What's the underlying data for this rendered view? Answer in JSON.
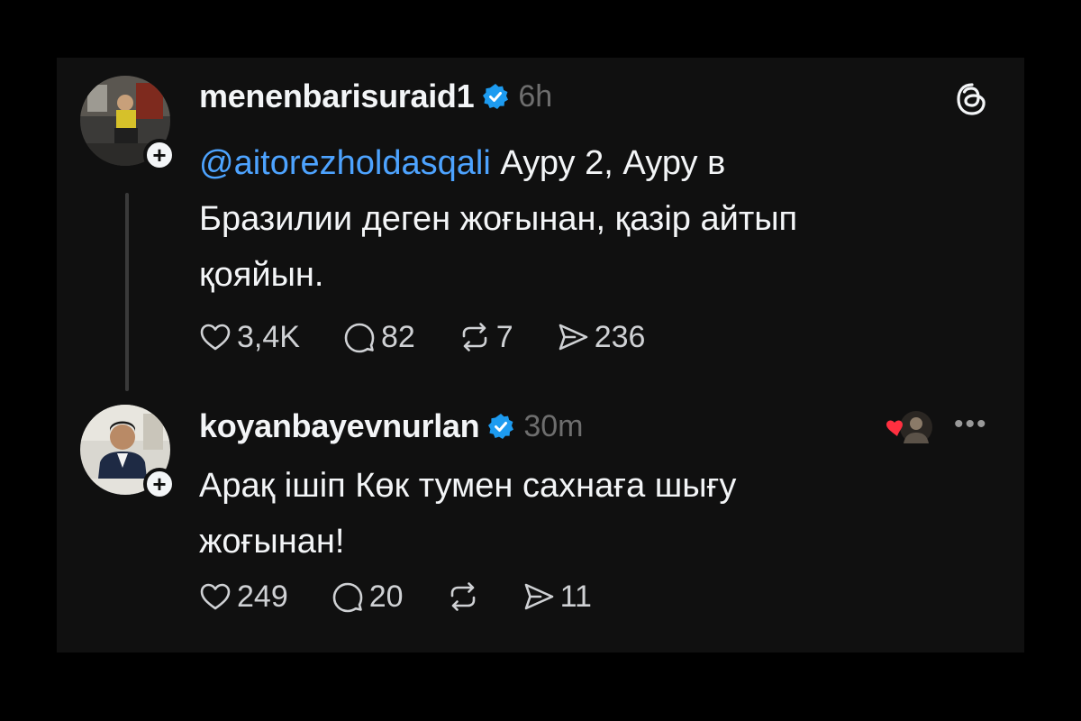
{
  "posts": [
    {
      "username": "menenbarisuraid1",
      "time": "6h",
      "mention": "@aitorezholdasqali",
      "text_line1": " Ауру 2, Ауру в",
      "text_line2": "Бразилии деген жоғынан, қазір айтып",
      "text_line3": "қояйын.",
      "likes": "3,4K",
      "replies": "82",
      "reposts": "7",
      "shares": "236",
      "avatar_icon": "person-photo-avatar",
      "colors": {
        "verified": "#1d9bf0",
        "mention": "#4da3ff"
      }
    },
    {
      "username": "koyanbayevnurlan",
      "time": "30m",
      "text_line1": "Арақ ішіп Көк тумен сахнаға шығу",
      "text_line2": "жоғынан!",
      "likes": "249",
      "replies": "20",
      "shares": "11",
      "avatar_icon": "person-photo-avatar",
      "colors": {
        "liked_heart": "#ff3040"
      }
    }
  ],
  "icons": [
    "threads-logo-icon",
    "verified-badge-icon",
    "heart-icon",
    "comment-icon",
    "repost-icon",
    "share-icon",
    "more-options-icon",
    "follow-plus-icon"
  ]
}
